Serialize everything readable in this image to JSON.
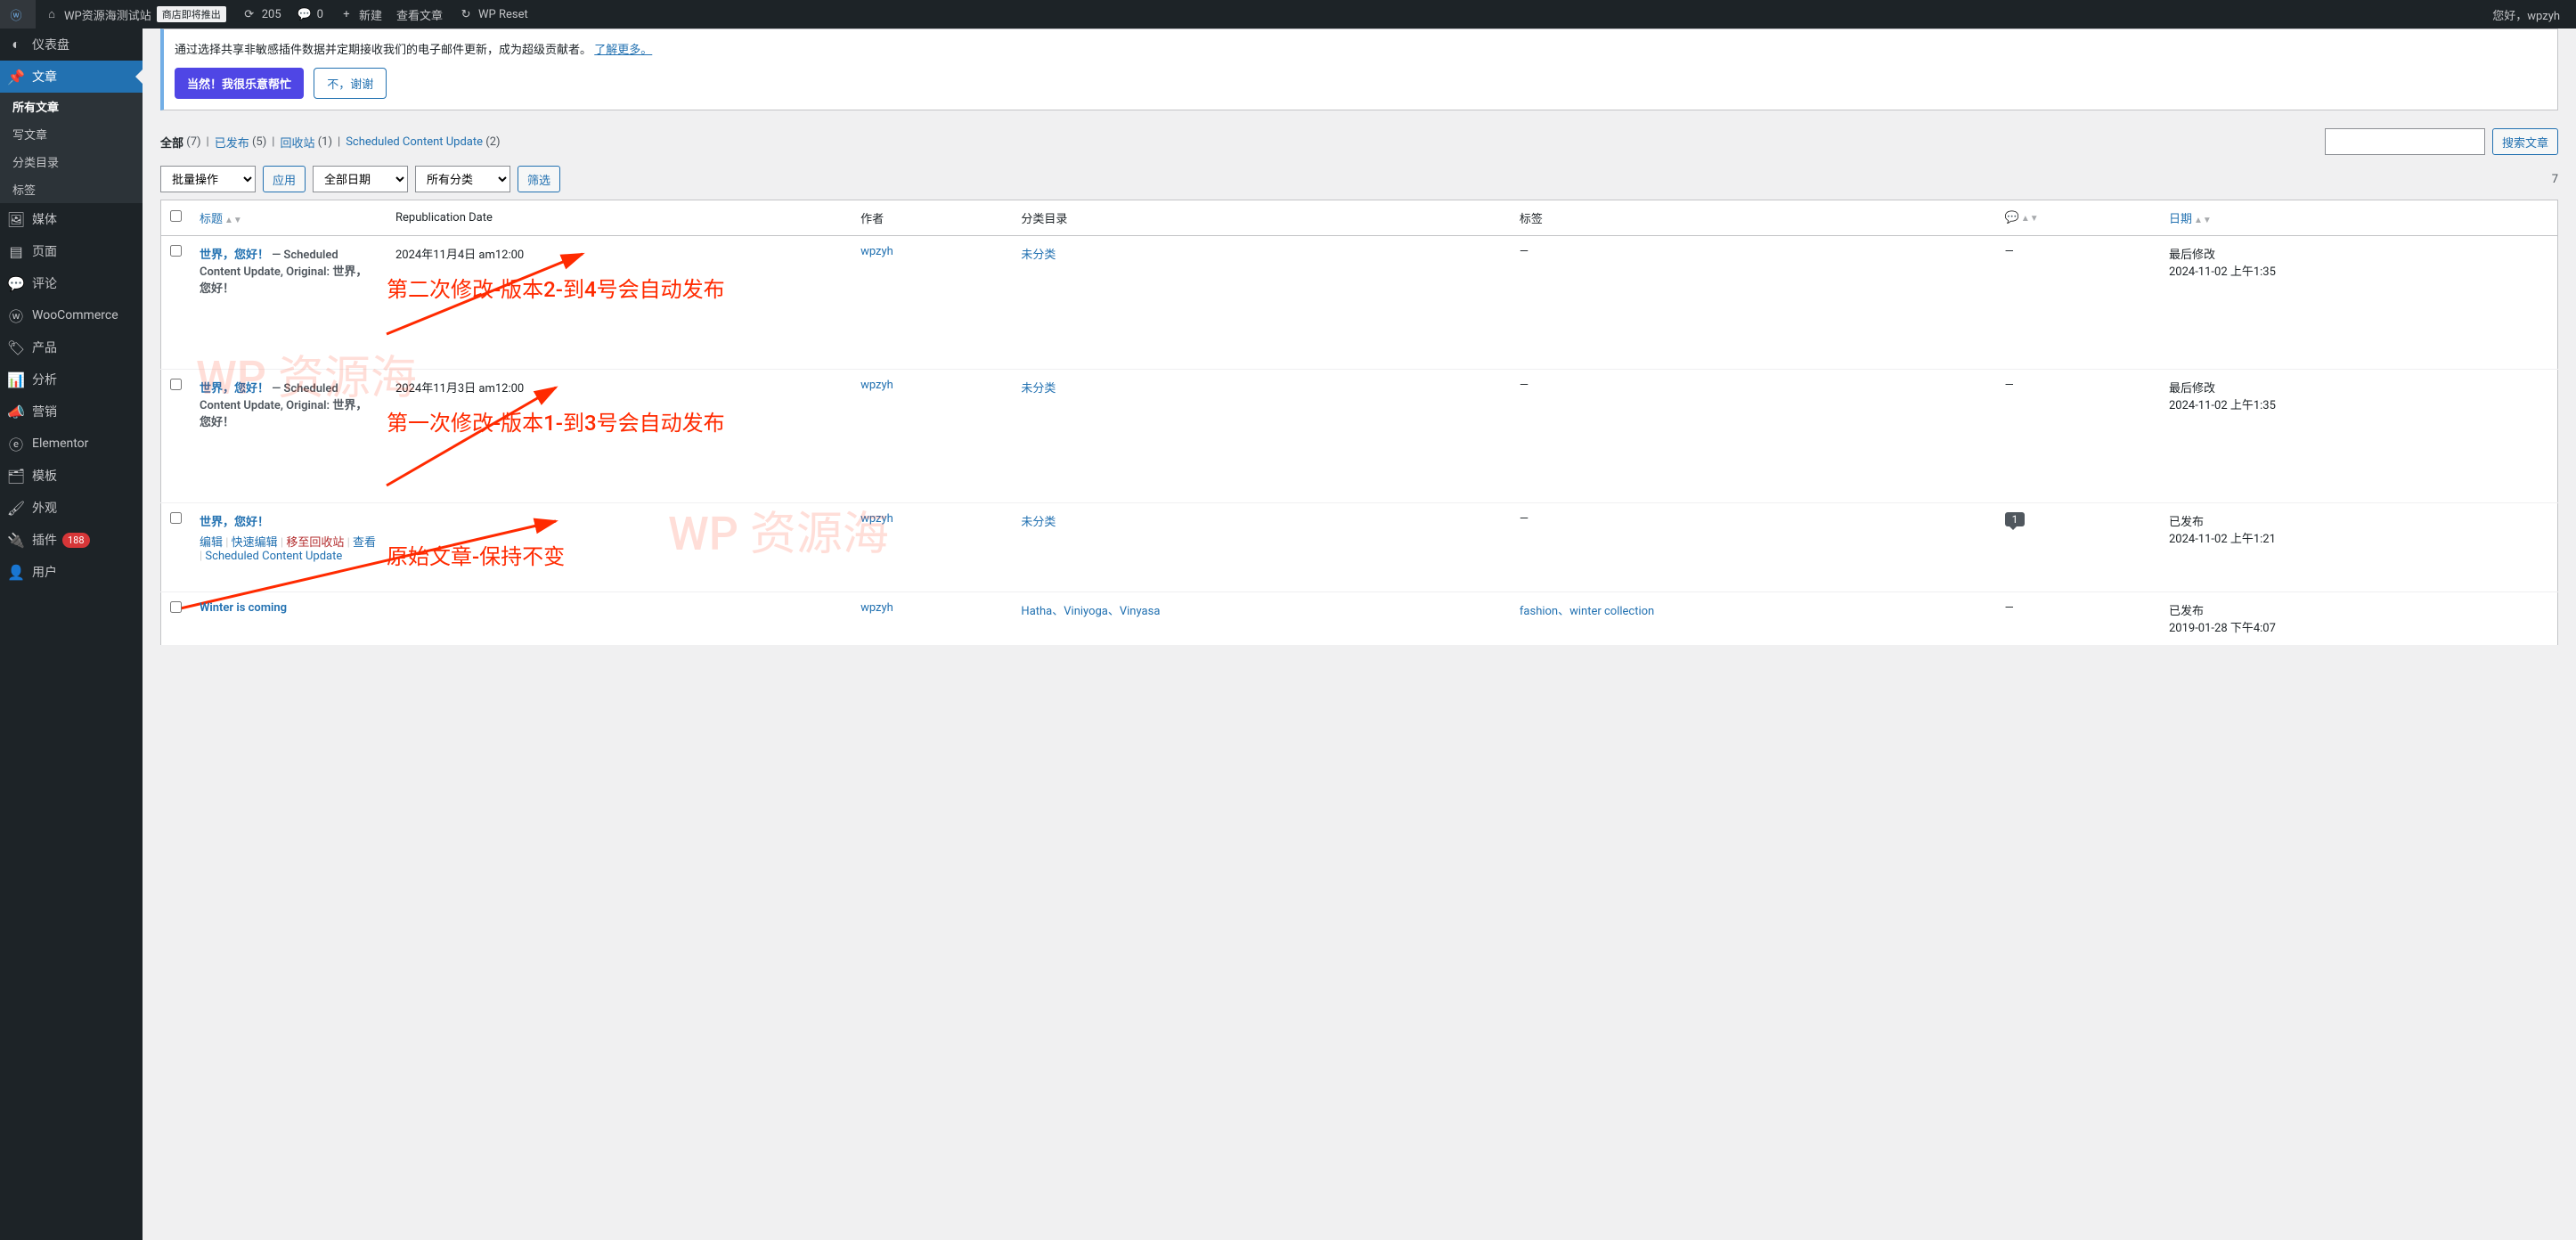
{
  "adminbar": {
    "site_name": "WP资源海测试站",
    "store_badge": "商店即将推出",
    "updates": "205",
    "comments": "0",
    "new": "新建",
    "view_post": "查看文章",
    "wp_reset": "WP Reset",
    "howdy": "您好，wpzyh"
  },
  "sidebar": {
    "items": [
      {
        "label": "仪表盘",
        "icon": "dashboard"
      },
      {
        "label": "文章",
        "icon": "pin"
      },
      {
        "label": "媒体",
        "icon": "media"
      },
      {
        "label": "页面",
        "icon": "page"
      },
      {
        "label": "评论",
        "icon": "comment"
      },
      {
        "label": "WooCommerce",
        "icon": "woo"
      },
      {
        "label": "产品",
        "icon": "product"
      },
      {
        "label": "分析",
        "icon": "analytics"
      },
      {
        "label": "营销",
        "icon": "marketing"
      },
      {
        "label": "Elementor",
        "icon": "elementor"
      },
      {
        "label": "模板",
        "icon": "template"
      },
      {
        "label": "外观",
        "icon": "appearance"
      },
      {
        "label": "插件",
        "icon": "plugin",
        "badge": "188"
      },
      {
        "label": "用户",
        "icon": "user"
      }
    ],
    "submenu": {
      "all_posts": "所有文章",
      "write_post": "写文章",
      "categories": "分类目录",
      "tags": "标签"
    }
  },
  "notice": {
    "text": "通过选择共享非敏感插件数据并定期接收我们的电子邮件更新，成为超级贡献者。",
    "link": "了解更多。",
    "accept": "当然！我很乐意帮忙",
    "decline": "不，谢谢"
  },
  "subsubsub": {
    "all": "全部",
    "all_count": "(7)",
    "published": "已发布",
    "published_count": "(5)",
    "trash": "回收站",
    "trash_count": "(1)",
    "scheduled": "Scheduled Content Update",
    "scheduled_count": "(2)"
  },
  "search": {
    "button": "搜索文章",
    "placeholder": ""
  },
  "tablenav": {
    "bulk": "批量操作",
    "apply": "应用",
    "all_dates": "全部日期",
    "all_cats": "所有分类",
    "filter": "筛选",
    "count_suffix": "7"
  },
  "columns": {
    "title": "标题",
    "repub": "Republication Date",
    "author": "作者",
    "categories": "分类目录",
    "tags": "标签",
    "date": "日期"
  },
  "rows": [
    {
      "title": "世界，您好！",
      "suffix": " — Scheduled Content Update, Original: 世界，您好！",
      "repub": "2024年11月4日 am12:00",
      "author": "wpzyh",
      "cats": "未分类",
      "tags": "—",
      "comments": "—",
      "date_status": "最后修改",
      "date_value": "2024-11-02 上午1:35",
      "actions": null,
      "annotation": "第二次修改-版本2-到4号会自动发布"
    },
    {
      "title": "世界，您好！",
      "suffix": " — Scheduled Content Update, Original: 世界，您好！",
      "repub": "2024年11月3日 am12:00",
      "author": "wpzyh",
      "cats": "未分类",
      "tags": "—",
      "comments": "—",
      "date_status": "最后修改",
      "date_value": "2024-11-02 上午1:35",
      "actions": null,
      "annotation": "第一次修改-版本1-到3号会自动发布"
    },
    {
      "title": "世界，您好！",
      "suffix": "",
      "repub": "",
      "author": "wpzyh",
      "cats": "未分类",
      "tags": "—",
      "comments": "1",
      "date_status": "已发布",
      "date_value": "2024-11-02 上午1:21",
      "actions": {
        "edit": "编辑",
        "quick": "快速编辑",
        "trash": "移至回收站",
        "view": "查看",
        "scu": "Scheduled Content Update"
      },
      "annotation": "原始文章-保持不变"
    },
    {
      "title": "Winter is coming",
      "suffix": "",
      "repub": "",
      "author": "wpzyh",
      "cats": "Hatha、Viniyoga、Vinyasa",
      "tags": "fashion、winter collection",
      "comments": "—",
      "date_status": "已发布",
      "date_value": "2019-01-28 下午4:07",
      "actions": null,
      "annotation": null
    }
  ],
  "watermark": "WP 资源海"
}
